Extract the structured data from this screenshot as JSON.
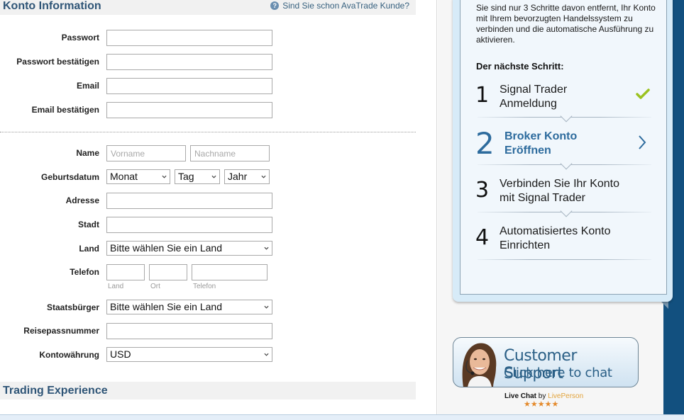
{
  "form": {
    "section_title": "Konto Information",
    "help_link": "Sind Sie schon AvaTrade Kunde?",
    "fields": {
      "password_label": "Passwort",
      "password_confirm_label": "Passwort bestätigen",
      "email_label": "Email",
      "email_confirm_label": "Email bestätigen",
      "name_label": "Name",
      "first_name_placeholder": "Vorname",
      "last_name_placeholder": "Nachname",
      "birthdate_label": "Geburtsdatum",
      "month_value": "Monat",
      "day_value": "Tag",
      "year_value": "Jahr",
      "address_label": "Adresse",
      "city_label": "Stadt",
      "country_label": "Land",
      "country_value": "Bitte wählen Sie ein Land",
      "phone_label": "Telefon",
      "phone_sub_country": "Land",
      "phone_sub_area": "Ort",
      "phone_sub_number": "Telefon",
      "citizenship_label": "Staatsbürger",
      "citizenship_value": "Bitte wählen Sie ein Land",
      "passport_label": "Reisepassnummer",
      "currency_label": "Kontowährung",
      "currency_value": "USD"
    },
    "next_section_title": "Trading Experience"
  },
  "sidebar": {
    "intro": "Sie sind nur 3 Schritte davon entfernt, Ihr Konto mit Ihrem bevorzugten Handelssystem zu verbinden und die automatische Ausführung zu aktivieren.",
    "next_step_heading": "Der nächste Schritt:",
    "steps": [
      {
        "num": "1",
        "line1": "Signal Trader",
        "line2": "Anmeldung",
        "status": "done"
      },
      {
        "num": "2",
        "line1": "Broker Konto",
        "line2": "Eröffnen",
        "status": "active"
      },
      {
        "num": "3",
        "line1": "Verbinden Sie Ihr Konto",
        "line2": "mit Signal Trader",
        "status": "pending"
      },
      {
        "num": "4",
        "line1": "Automatisiertes Konto",
        "line2": "Einrichten",
        "status": "pending"
      }
    ],
    "support": {
      "title": "Customer Support",
      "subtitle": "Click here to chat",
      "live_chat": "Live Chat",
      "by": "by",
      "provider": "LivePerson",
      "stars": "★★★★★"
    }
  },
  "colors": {
    "accent": "#2d6b9d",
    "section_title": "#2f5577",
    "sidebar_bar": "#12507f",
    "check": "#9bc21f",
    "provider": "#e2a33b"
  }
}
